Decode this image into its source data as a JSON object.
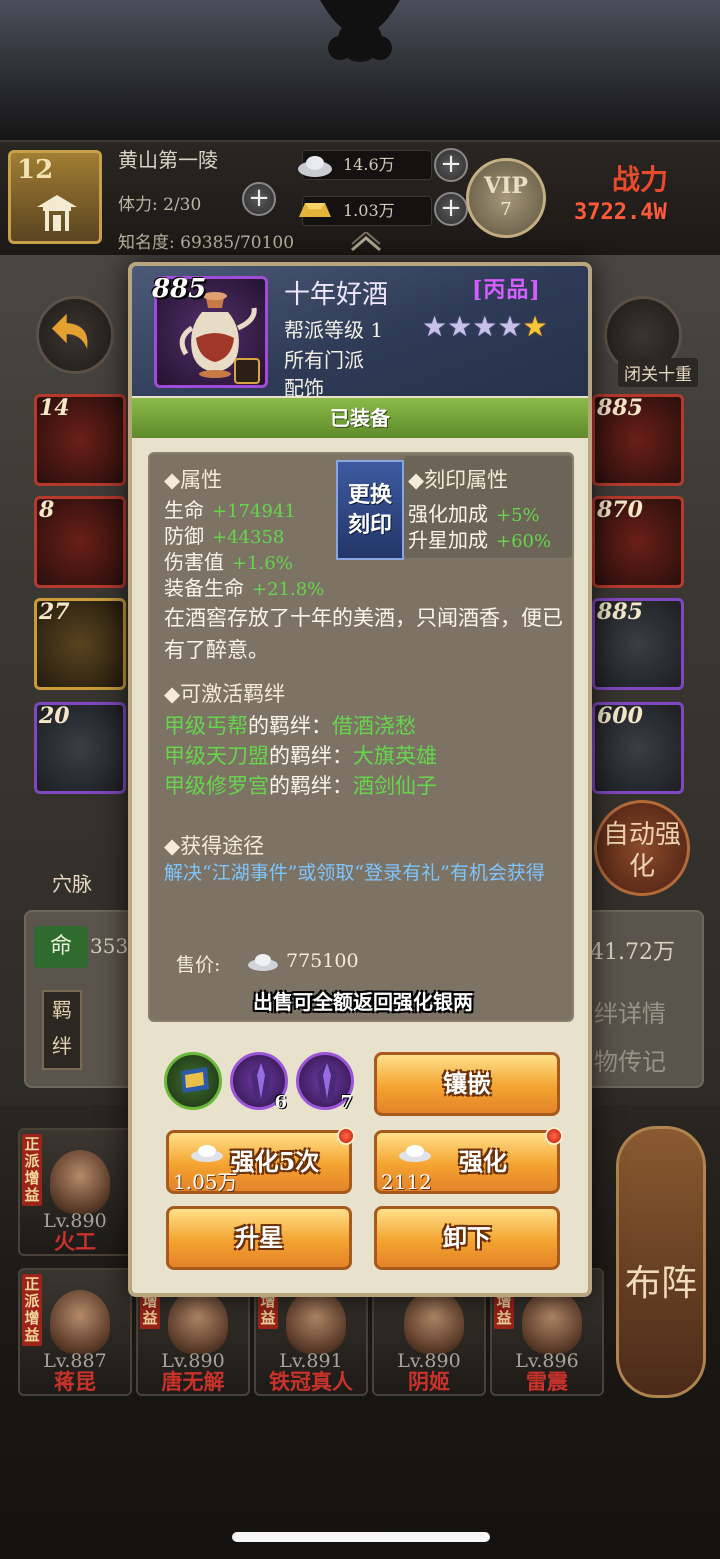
{
  "header": {
    "player_level": "12",
    "location": "黄山第一陵",
    "stamina": "体力: 2/30",
    "fame": "知名度: 69385/70100",
    "silver": "14.6万",
    "gold": "1.03万",
    "vip_label": "VIP",
    "vip_level": "7",
    "power_label": "战力",
    "power_value": "3722.4W"
  },
  "side_left": [
    {
      "num": "14"
    },
    {
      "num": "8"
    },
    {
      "num": "27"
    },
    {
      "num": "20"
    }
  ],
  "side_right": [
    {
      "num": "885"
    },
    {
      "num": "870"
    },
    {
      "num": "885"
    },
    {
      "num": "600"
    }
  ],
  "background": {
    "retreat_label": "闭关十重",
    "auto_enhance_label": "自动强化",
    "acupoint_label": "穴脉",
    "ming_label": "命",
    "panel_left_value": "353",
    "panel_right_value": "41.72万",
    "bond_detail_label": "绊详情",
    "treasure_note_label": "物传记",
    "bond_tab_label": "羁绊",
    "formation_label": "布阵"
  },
  "heroes_row1": [
    {
      "badge": "正派增益",
      "lv": "Lv.890",
      "name": "火工"
    }
  ],
  "heroes_row2": [
    {
      "badge": "正派增益",
      "lv": "Lv.887",
      "name": "蒋昆"
    },
    {
      "badge": "派增益",
      "lv": "Lv.890",
      "name": "唐无解"
    },
    {
      "badge": "派增益",
      "lv": "Lv.891",
      "name": "铁冠真人"
    },
    {
      "badge": "",
      "lv": "Lv.890",
      "name": "阴姬"
    },
    {
      "badge": "派增益",
      "lv": "Lv.896",
      "name": "雷震"
    }
  ],
  "item": {
    "level": "885",
    "name": "十年好酒",
    "grade": "[丙品]",
    "guild_level": "帮派等级 1",
    "faction": "所有门派",
    "slot": "配饰",
    "stars_total": 5,
    "stars_gold": 1,
    "equipped_label": "已装备"
  },
  "attributes": {
    "title": "◆属性",
    "rows": [
      {
        "name": "生命",
        "value": "+174941"
      },
      {
        "name": "防御",
        "value": "+44358"
      },
      {
        "name": "伤害值",
        "value": "+1.6%"
      },
      {
        "name": "装备生命",
        "value": "+21.8%"
      }
    ]
  },
  "engrave": {
    "button_label": "更换刻印",
    "title": "◆刻印属性",
    "rows": [
      {
        "name": "强化加成",
        "value": "+5%"
      },
      {
        "name": "升星加成",
        "value": "+60%"
      }
    ]
  },
  "description": "在酒窖存放了十年的美酒，只闻酒香，便已有了醉意。",
  "bonds": {
    "title": "◆可激活羁绊",
    "rows": [
      {
        "group": "甲级丐帮",
        "mid": "的羁绊：",
        "name": "借酒浇愁"
      },
      {
        "group": "甲级天刀盟",
        "mid": "的羁绊：",
        "name": "大旗英雄"
      },
      {
        "group": "甲级修罗宫",
        "mid": "的羁绊：",
        "name": "酒剑仙子"
      }
    ]
  },
  "source": {
    "title": "◆获得途径",
    "text": "解决“江湖事件”或领取“登录有礼”有机会获得"
  },
  "price": {
    "label": "售价:",
    "value": "775100",
    "refund_note": "出售可全额返回强化银两"
  },
  "gems": [
    {
      "count": ""
    },
    {
      "count": "6"
    },
    {
      "count": "7"
    }
  ],
  "actions": {
    "inlay": "镶嵌",
    "enhance5": "强化5次",
    "enhance5_cost": "1.05万",
    "enhance": "强化",
    "enhance_cost": "2112",
    "star_up": "升星",
    "unequip": "卸下"
  }
}
